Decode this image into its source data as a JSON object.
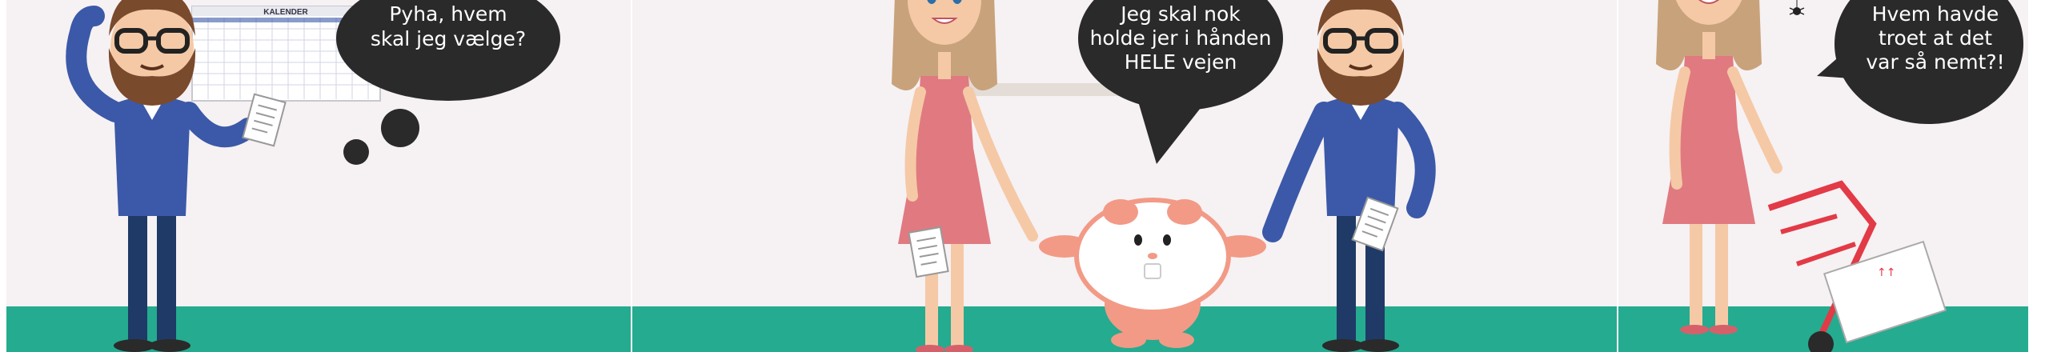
{
  "comic": {
    "panels": [
      {
        "speech": [
          "Pyha, hvem",
          "skal jeg vælge?"
        ],
        "calendar_title": "KALENDER"
      },
      {
        "speech": [
          "Jeg skal nok",
          "holde jer i hånden",
          "HELE vejen"
        ]
      },
      {
        "speech": [
          "Hvem havde",
          "troet at det",
          "var så nemt?!"
        ]
      }
    ],
    "colors": {
      "wall": "#f6f1f3",
      "floor": "#25ab90",
      "bubble": "#2a2a2a",
      "sweater": "#3b59a8",
      "dress": "#e07a80",
      "hair_woman": "#c8a27a",
      "mascot": "#f29a86"
    }
  }
}
